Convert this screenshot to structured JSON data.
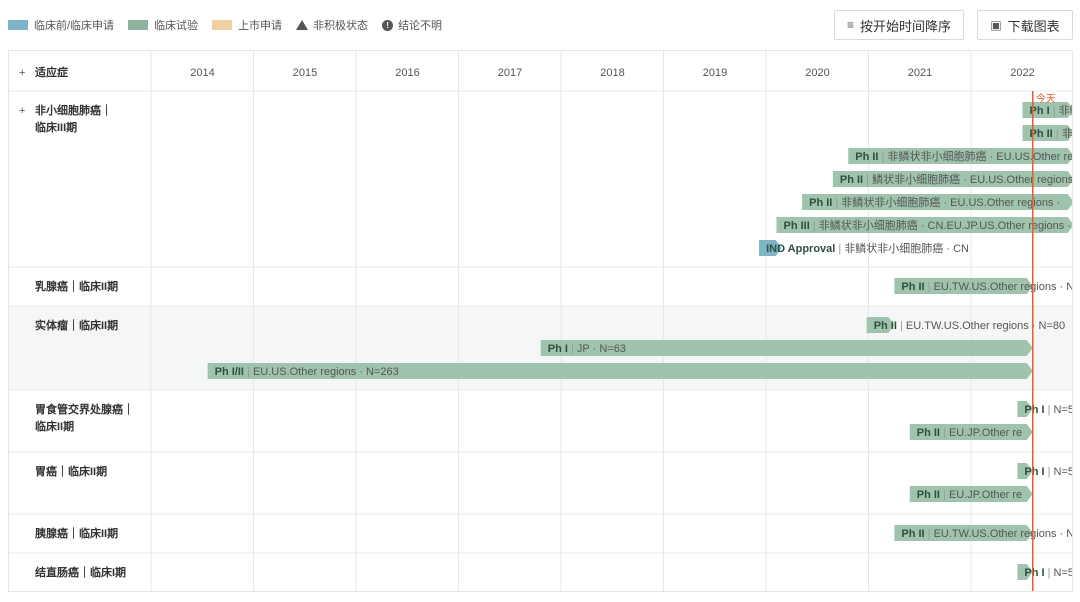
{
  "legend": [
    {
      "label": "临床前/临床申请",
      "color": "#7fb3c7",
      "kind": "swatch"
    },
    {
      "label": "临床试验",
      "color": "#8fb39f",
      "kind": "swatch"
    },
    {
      "label": "上市申请",
      "color": "#f0cfa0",
      "kind": "swatch"
    },
    {
      "label": "非积极状态",
      "kind": "triangle"
    },
    {
      "label": "结论不明",
      "kind": "exclamation"
    }
  ],
  "toolbar": {
    "sort_label": "按开始时间降序",
    "sort_icon": "sort-list-icon",
    "download_label": "下载图表",
    "download_icon": "chart-image-icon"
  },
  "chart_data": {
    "type": "gantt",
    "column_header": "适应症",
    "expand_symbol": "+",
    "x_axis": {
      "ticks": [
        "2014",
        "2015",
        "2016",
        "2017",
        "2018",
        "2019",
        "2020",
        "2021",
        "2022"
      ],
      "range": [
        2013.5,
        2022.5
      ]
    },
    "today": {
      "label": "今天",
      "value": 2022.1,
      "color": "#e85d2f"
    },
    "colors": {
      "trial": "#9fc3ac",
      "ind": "#7fb3c7",
      "label_phase": "#2f4f3f",
      "label_detail": "#555555",
      "grid": "#e8e8e8",
      "alt_row": "#f4f6f8"
    },
    "rows": [
      {
        "label": "非小细胞肺癌｜临床III期",
        "expandable": true,
        "shaded": false,
        "lines": 2,
        "bars": [
          {
            "phase": "Ph I",
            "detail": "非鳞",
            "start": 2022.0,
            "end": 2022.5,
            "kind": "trial"
          },
          {
            "phase": "Ph II",
            "detail": "非鳞",
            "start": 2022.0,
            "end": 2022.5,
            "kind": "trial"
          },
          {
            "phase": "Ph II",
            "detail": "非鳞状非小细胞肺癌 · EU.US.Other re",
            "start": 2020.3,
            "end": 2022.5,
            "kind": "trial"
          },
          {
            "phase": "Ph II",
            "detail": "鳞状非小细胞肺癌 · EU.US.Other regions",
            "start": 2020.15,
            "end": 2022.5,
            "kind": "trial"
          },
          {
            "phase": "Ph II",
            "detail": "非鳞状非小细胞肺癌 · EU.US.Other regions ·",
            "start": 2019.85,
            "end": 2022.5,
            "kind": "trial"
          },
          {
            "phase": "Ph III",
            "detail": "非鳞状非小细胞肺癌 · CN.EU.JP.US.Other regions ·",
            "start": 2019.6,
            "end": 2022.5,
            "kind": "trial"
          },
          {
            "phase": "IND Approval",
            "detail": "非鳞状非小细胞肺癌 · CN",
            "start": 2019.43,
            "end": 2019.65,
            "kind": "ind"
          }
        ]
      },
      {
        "label": "乳腺癌｜临床II期",
        "expandable": false,
        "shaded": false,
        "lines": 1,
        "bars": [
          {
            "phase": "Ph II",
            "detail": "EU.TW.US.Other regions · N",
            "start": 2020.75,
            "end": 2022.1,
            "kind": "trial"
          }
        ]
      },
      {
        "label": "实体瘤｜临床II期",
        "expandable": false,
        "shaded": true,
        "lines": 1,
        "bars": [
          {
            "phase": "Ph II",
            "detail": "EU.TW.US.Other regions · N=80",
            "start": 2020.48,
            "end": 2020.75,
            "kind": "trial"
          },
          {
            "phase": "Ph I",
            "detail": "JP · N=63",
            "start": 2017.3,
            "end": 2022.1,
            "kind": "trial"
          },
          {
            "phase": "Ph I/II",
            "detail": "EU.US.Other regions · N=263",
            "start": 2014.05,
            "end": 2022.1,
            "kind": "trial"
          }
        ]
      },
      {
        "label": "胃食管交界处腺癌｜临床II期",
        "expandable": false,
        "shaded": false,
        "lines": 2,
        "bars": [
          {
            "phase": "Ph I",
            "detail": "N=5",
            "start": 2021.95,
            "end": 2022.1,
            "kind": "trial"
          },
          {
            "phase": "Ph II",
            "detail": "EU.JP.Other re",
            "start": 2020.9,
            "end": 2022.1,
            "kind": "trial"
          }
        ]
      },
      {
        "label": "胃癌｜临床II期",
        "expandable": false,
        "shaded": false,
        "lines": 1,
        "bars": [
          {
            "phase": "Ph I",
            "detail": "N=5",
            "start": 2021.95,
            "end": 2022.1,
            "kind": "trial"
          },
          {
            "phase": "Ph II",
            "detail": "EU.JP.Other re",
            "start": 2020.9,
            "end": 2022.1,
            "kind": "trial"
          }
        ]
      },
      {
        "label": "胰腺癌｜临床II期",
        "expandable": false,
        "shaded": false,
        "lines": 1,
        "bars": [
          {
            "phase": "Ph II",
            "detail": "EU.TW.US.Other regions · N",
            "start": 2020.75,
            "end": 2022.1,
            "kind": "trial"
          }
        ]
      },
      {
        "label": "结直肠癌｜临床I期",
        "expandable": false,
        "shaded": false,
        "lines": 1,
        "bars": [
          {
            "phase": "Ph I",
            "detail": "N=5",
            "start": 2021.95,
            "end": 2022.1,
            "kind": "trial"
          }
        ]
      }
    ]
  }
}
